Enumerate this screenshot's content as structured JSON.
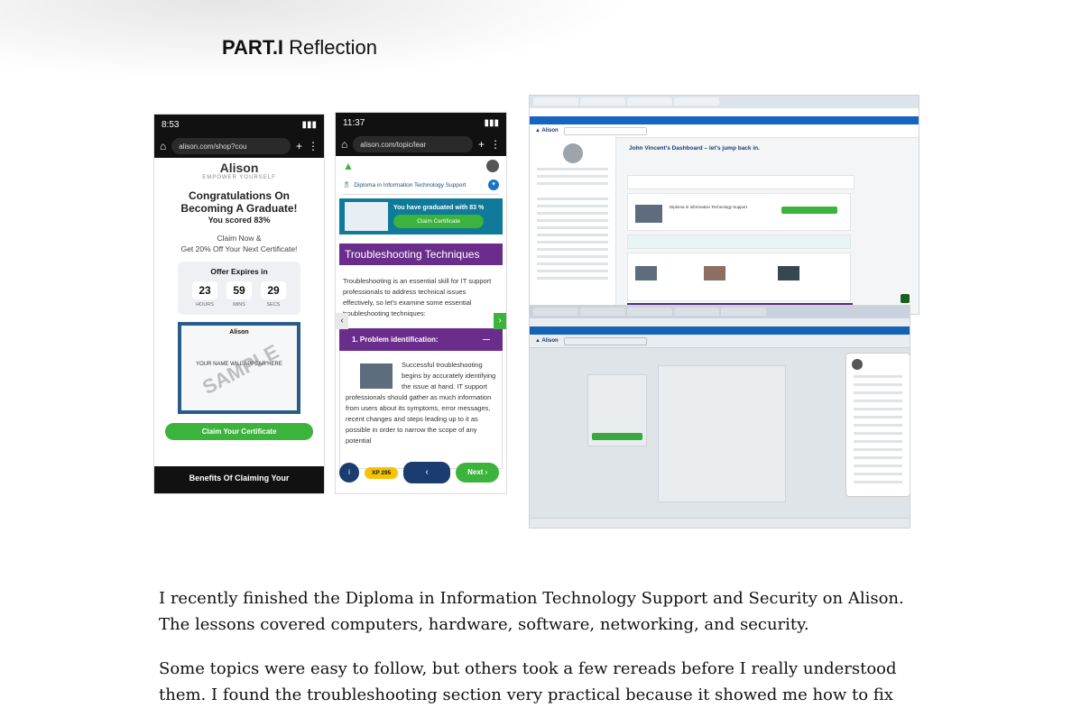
{
  "heading": {
    "bold": "PART.I",
    "rest": "Reflection"
  },
  "phone1": {
    "time": "8:53",
    "url": "alison.com/shop?cou",
    "logo": "Alison",
    "tagline": "EMPOWER YOURSELF",
    "congrats_line1": "Congratulations On",
    "congrats_line2": "Becoming A Graduate!",
    "score": "You scored 83%",
    "claim_now": "Claim Now &",
    "get_off": "Get 20% Off Your Next Certificate!",
    "offer_title": "Offer Expires in",
    "countdown": [
      {
        "value": "23",
        "unit": "HOURS"
      },
      {
        "value": "59",
        "unit": "MINS"
      },
      {
        "value": "29",
        "unit": "SECS"
      }
    ],
    "cert_logo": "Alison",
    "cert_name": "YOUR NAME WILL APPEAR HERE",
    "cert_watermark": "SAMPLE",
    "claim_button": "Claim Your Certificate",
    "footer": "Benefits Of Claiming Your"
  },
  "phone2": {
    "time": "11:37",
    "url": "alison.com/topic/lear",
    "course": "Diploma in Information Technology Support",
    "graduated": "You have graduated with 83 %",
    "claim_button": "Claim Certificate",
    "section_title": "Troubleshooting Techniques",
    "intro": "Troubleshooting is an essential skill for IT support professionals to address technical issues effectively, so let's examine some essential troubleshooting techniques:",
    "accordion_title": "1. Problem identification:",
    "accordion_text": "Successful troubleshooting begins by accurately identifying the issue at hand. IT support professionals should gather as much information from users about its symptoms, error messages, recent changes and steps leading up to it as possible in order to narrow the scope of any potential",
    "xp": "XP 295",
    "next": "Next"
  },
  "desktop1": {
    "title": "John Vincent's Dashboard – let's jump back in.",
    "course": "Diploma in Information Technology Support"
  },
  "paragraphs": [
    "I recently finished the Diploma in Information Technology Support and Security on Alison.",
    "The lessons covered computers, hardware, software, networking, and security.",
    "Some topics were easy to follow, but others took a few rereads before I really understood",
    "them. I found the troubleshooting section very practical because it showed me how to fix"
  ],
  "colors": {
    "alison_green": "#3cb33c",
    "alison_purple": "#6b2d8c",
    "alison_teal": "#0f7a9a",
    "alison_navy": "#1a3c6e"
  }
}
